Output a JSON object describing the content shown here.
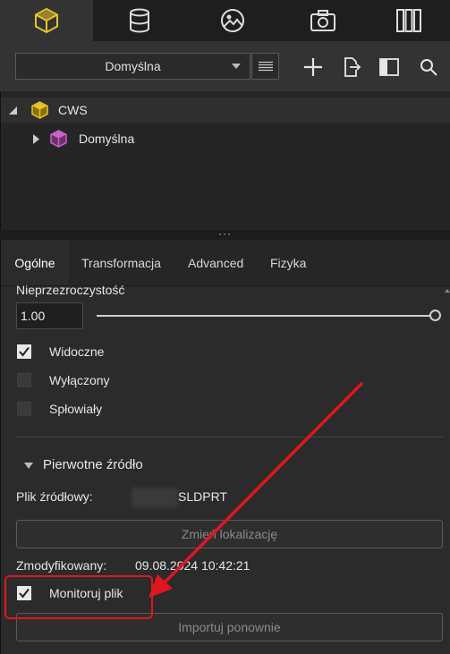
{
  "toolbar": {
    "tabs": [
      {
        "icon": "cube-icon",
        "active": true
      },
      {
        "icon": "database-icon",
        "active": false
      },
      {
        "icon": "image-icon",
        "active": false
      },
      {
        "icon": "camera-icon",
        "active": false
      },
      {
        "icon": "library-icon",
        "active": false
      }
    ]
  },
  "preset": {
    "selected": "Domyślna",
    "actions": [
      "add-icon",
      "export-icon",
      "panel-icon",
      "search-icon"
    ]
  },
  "tree": {
    "root": {
      "label": "CWS",
      "icon": "cube-icon",
      "color": "#e8c22a"
    },
    "child": {
      "label": "Domyślna",
      "icon": "cube-icon",
      "color": "#c865c8"
    }
  },
  "splitter": {
    "dots": "···"
  },
  "tabs": [
    "Ogólne",
    "Transformacja",
    "Advanced",
    "Fizyka"
  ],
  "general": {
    "opacity_label": "Nieprzezroczystość",
    "opacity_value": "1.00",
    "opacity_level": 1.0,
    "checkboxes": [
      {
        "label": "Widoczne",
        "checked": true
      },
      {
        "label": "Wyłączony",
        "checked": false
      },
      {
        "label": "Spłowiały",
        "checked": false
      }
    ]
  },
  "source": {
    "section_title": "Pierwotne źródło",
    "file_label": "Plik źródłowy:",
    "file_value": "SLDPRT",
    "relocate_button": "Zmień lokalizację",
    "modified_label": "Zmodyfikowany:",
    "modified_value": "09.08.2024 10:42:21",
    "monitor_label": "Monitoruj plik",
    "monitor_checked": true,
    "reimport_button": "Importuj ponownie"
  },
  "colors": {
    "accent": "#e8c22a",
    "annotation": "#e0161f"
  }
}
